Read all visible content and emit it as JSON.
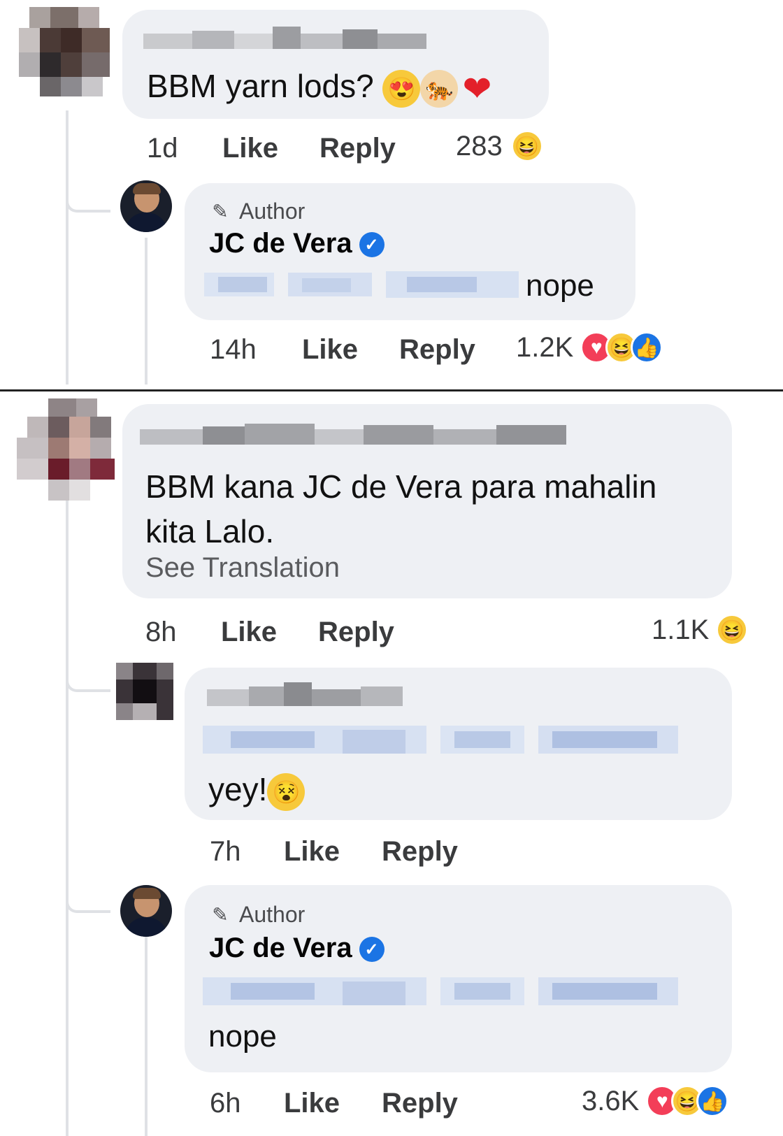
{
  "panel1": {
    "comment": {
      "text": "BBM yarn lods?",
      "emojis": [
        "😍",
        "🐅",
        "❤"
      ],
      "time": "1d",
      "like": "Like",
      "reply": "Reply",
      "reaction_count": "283",
      "reactions": [
        "haha"
      ]
    },
    "reply": {
      "badge": "Author",
      "author": "JC de Vera",
      "text": "nope",
      "time": "14h",
      "like": "Like",
      "reply": "Reply",
      "reaction_count": "1.2K",
      "reactions": [
        "heart",
        "haha",
        "like"
      ]
    }
  },
  "panel2": {
    "comment": {
      "text_line1": "BBM kana JC de Vera para mahalin",
      "text_line2": "kita Lalo.",
      "see_translation": "See Translation",
      "time": "8h",
      "like": "Like",
      "reply": "Reply",
      "reaction_count": "1.1K",
      "reactions": [
        "haha"
      ]
    },
    "reply1": {
      "text": "yey!",
      "emoji": "😵",
      "time": "7h",
      "like": "Like",
      "reply": "Reply"
    },
    "reply2": {
      "badge": "Author",
      "author": "JC de Vera",
      "text": "nope",
      "time": "6h",
      "like": "Like",
      "reply": "Reply",
      "reaction_count": "3.6K",
      "reactions": [
        "heart",
        "haha",
        "like"
      ]
    }
  },
  "colors": {
    "bubble": "#eef0f4",
    "divider": "#222222",
    "verified": "#1b74e4",
    "reaction_like": "#1b74e4",
    "reaction_heart": "#f33e58",
    "reaction_haha": "#f7c93b"
  },
  "icons": {
    "author_badge": "pencil-icon",
    "verified": "verified-check-icon"
  }
}
